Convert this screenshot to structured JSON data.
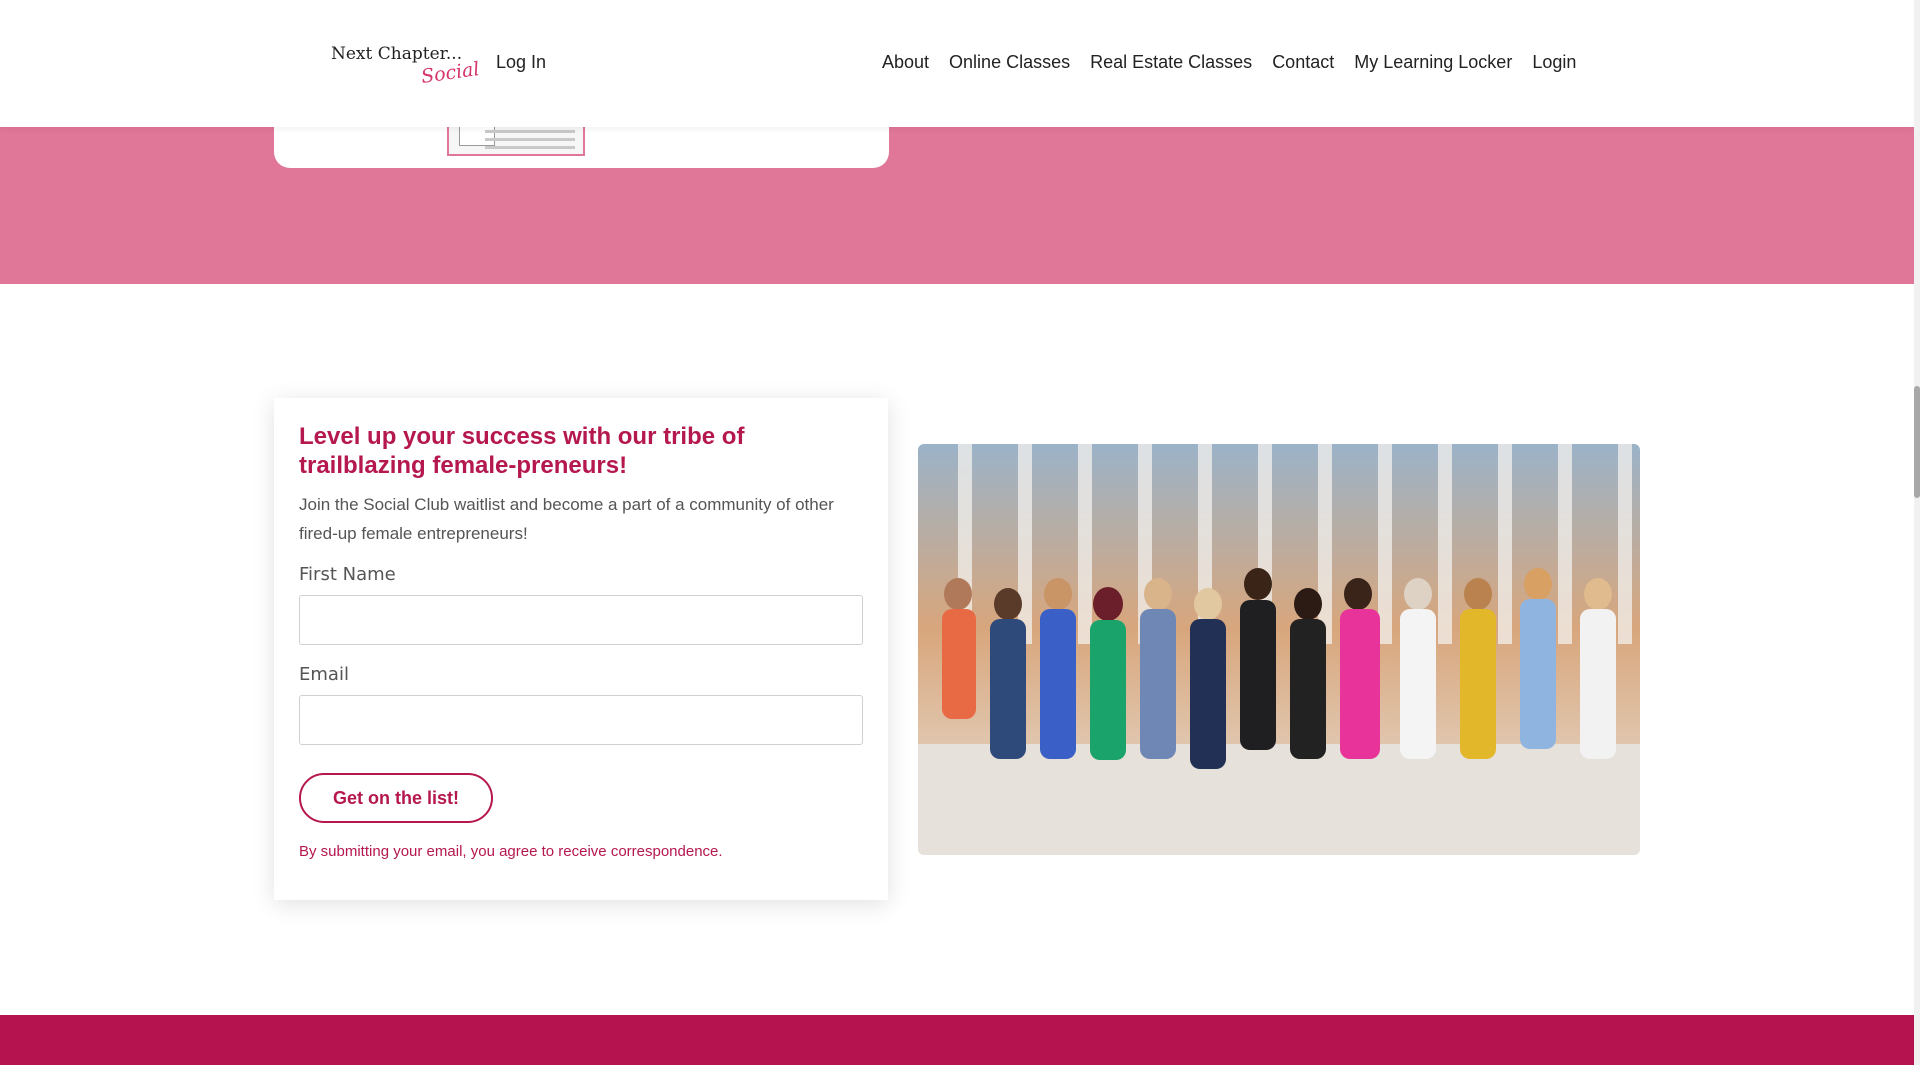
{
  "header": {
    "logo_main": "Next Chapter...",
    "logo_script": "Social",
    "login_link": "Log In",
    "nav": [
      "About",
      "Online Classes",
      "Real Estate Classes",
      "Contact",
      "My Learning Locker",
      "Login"
    ]
  },
  "form": {
    "title": "Level up your success with our tribe of trailblazing female-preneurs!",
    "description": "Join the Social Club waitlist and become a part of a community of other fired-up female entrepreneurs!",
    "first_name_label": "First Name",
    "first_name_value": "",
    "email_label": "Email",
    "email_value": "",
    "submit_label": "Get on the list!",
    "consent": "By submitting your email, you agree to receive correspondence."
  },
  "colors": {
    "pink_band": "#e07698",
    "accent": "#b5174f",
    "footer": "#b5134f"
  }
}
